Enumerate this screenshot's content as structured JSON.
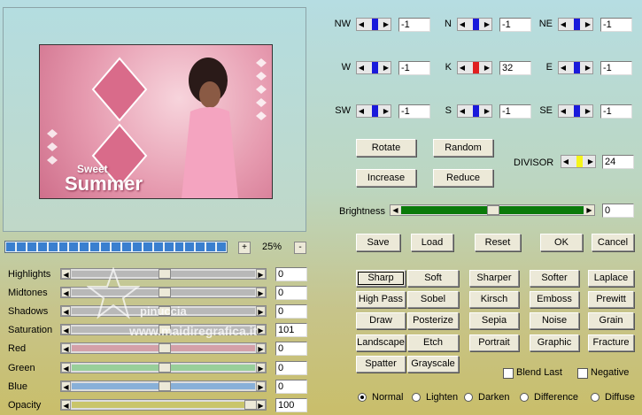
{
  "preview": {
    "title_small": "Sweet",
    "title_big": "Summer"
  },
  "zoom": {
    "plus": "+",
    "minus": "-",
    "value": "25%"
  },
  "progress_segments": 21,
  "adjustments": [
    {
      "label": "Highlights",
      "value": "0",
      "level": 50,
      "color": "#b8b8b8"
    },
    {
      "label": "Midtones",
      "value": "0",
      "level": 50,
      "color": "#b8b8b8"
    },
    {
      "label": "Shadows",
      "value": "0",
      "level": 50,
      "color": "#b8b8b8"
    },
    {
      "label": "Saturation",
      "value": "101",
      "level": 50,
      "color": "#b8b8b8"
    },
    {
      "label": "Red",
      "value": "0",
      "level": 50,
      "color": "#d4a0a8"
    },
    {
      "label": "Green",
      "value": "0",
      "level": 50,
      "color": "#98cf9a"
    },
    {
      "label": "Blue",
      "value": "0",
      "level": 50,
      "color": "#88b0d8"
    },
    {
      "label": "Opacity",
      "value": "100",
      "level": 100,
      "color": "#c9c56a"
    }
  ],
  "matrix": [
    {
      "label": "NW",
      "value": "-1",
      "color": "#1a1adb"
    },
    {
      "label": "N",
      "value": "-1",
      "color": "#1a1adb"
    },
    {
      "label": "NE",
      "value": "-1",
      "color": "#1a1adb"
    },
    {
      "label": "W",
      "value": "-1",
      "color": "#1a1adb"
    },
    {
      "label": "K",
      "value": "32",
      "color": "#e02020"
    },
    {
      "label": "E",
      "value": "-1",
      "color": "#1a1adb"
    },
    {
      "label": "SW",
      "value": "-1",
      "color": "#1a1adb"
    },
    {
      "label": "S",
      "value": "-1",
      "color": "#1a1adb"
    },
    {
      "label": "SE",
      "value": "-1",
      "color": "#1a1adb"
    }
  ],
  "actions": {
    "rotate": "Rotate",
    "random": "Random",
    "increase": "Increase",
    "reduce": "Reduce"
  },
  "divisor": {
    "label": "DIVISOR",
    "value": "24",
    "color": "#f5f51a"
  },
  "brightness": {
    "label": "Brightness",
    "value": "0",
    "level": 50,
    "color": "#0a7a0a"
  },
  "dialog": {
    "save": "Save",
    "load": "Load",
    "reset": "Reset",
    "ok": "OK",
    "cancel": "Cancel"
  },
  "presets": [
    "Sharp",
    "Soft",
    "Sharper",
    "Softer",
    "Laplace",
    "High Pass",
    "Sobel",
    "Kirsch",
    "Emboss",
    "Prewitt",
    "Draw",
    "Posterize",
    "Sepia",
    "Noise",
    "Grain",
    "Landscape",
    "Etch",
    "Portrait",
    "Graphic",
    "Fracture",
    "Spatter",
    "Grayscale"
  ],
  "options": {
    "blend_last": "Blend Last",
    "negative": "Negative"
  },
  "modes": {
    "selected": "Normal",
    "items": [
      "Normal",
      "Lighten",
      "Darken",
      "Difference",
      "Diffuse"
    ]
  },
  "watermark": {
    "line1": "pinuccia",
    "line2": "www.maidiregrafica.it"
  }
}
